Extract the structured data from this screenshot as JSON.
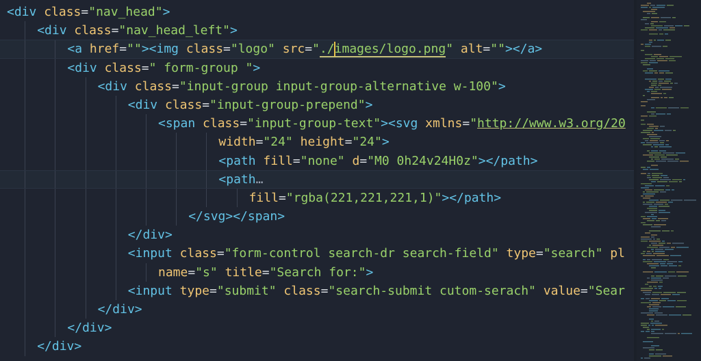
{
  "editor": {
    "language": "html",
    "lines": [
      {
        "indent": 0,
        "current": false,
        "tokens": [
          {
            "t": "tag",
            "v": "<div"
          },
          {
            "t": "sp",
            "v": " "
          },
          {
            "t": "attr",
            "v": "class"
          },
          {
            "t": "eq",
            "v": "="
          },
          {
            "t": "str",
            "v": "\"nav_head\""
          },
          {
            "t": "tag",
            "v": ">"
          }
        ]
      },
      {
        "indent": 1,
        "current": false,
        "tokens": [
          {
            "t": "tag",
            "v": "<div"
          },
          {
            "t": "sp",
            "v": " "
          },
          {
            "t": "attr",
            "v": "class"
          },
          {
            "t": "eq",
            "v": "="
          },
          {
            "t": "str",
            "v": "\"nav_head_left\""
          },
          {
            "t": "tag",
            "v": ">"
          }
        ]
      },
      {
        "indent": 2,
        "current": true,
        "tokens": [
          {
            "t": "tag",
            "v": "<a"
          },
          {
            "t": "sp",
            "v": " "
          },
          {
            "t": "attr",
            "v": "href"
          },
          {
            "t": "eq",
            "v": "="
          },
          {
            "t": "str",
            "v": "\"\""
          },
          {
            "t": "tag",
            "v": "><img"
          },
          {
            "t": "sp",
            "v": " "
          },
          {
            "t": "attr",
            "v": "class"
          },
          {
            "t": "eq",
            "v": "="
          },
          {
            "t": "str",
            "v": "\"logo\""
          },
          {
            "t": "sp",
            "v": " "
          },
          {
            "t": "attr",
            "v": "src"
          },
          {
            "t": "eq",
            "v": "="
          },
          {
            "t": "str",
            "v": "\""
          },
          {
            "t": "strul",
            "v": "./"
          },
          {
            "t": "cursor",
            "v": ""
          },
          {
            "t": "strul",
            "v": "images/logo.png"
          },
          {
            "t": "str",
            "v": "\""
          },
          {
            "t": "sp",
            "v": " "
          },
          {
            "t": "attr",
            "v": "alt"
          },
          {
            "t": "eq",
            "v": "="
          },
          {
            "t": "str",
            "v": "\"\""
          },
          {
            "t": "tag",
            "v": "></a>"
          }
        ]
      },
      {
        "indent": 2,
        "current": false,
        "tokens": [
          {
            "t": "tag",
            "v": "<div"
          },
          {
            "t": "sp",
            "v": " "
          },
          {
            "t": "attr",
            "v": "class"
          },
          {
            "t": "eq",
            "v": "="
          },
          {
            "t": "str",
            "v": "\" form-group \""
          },
          {
            "t": "tag",
            "v": ">"
          }
        ]
      },
      {
        "indent": 3,
        "current": false,
        "tokens": [
          {
            "t": "tag",
            "v": "<div"
          },
          {
            "t": "sp",
            "v": " "
          },
          {
            "t": "attr",
            "v": "class"
          },
          {
            "t": "eq",
            "v": "="
          },
          {
            "t": "str",
            "v": "\"input-group input-group-alternative w-100\""
          },
          {
            "t": "tag",
            "v": ">"
          }
        ]
      },
      {
        "indent": 4,
        "current": false,
        "tokens": [
          {
            "t": "tag",
            "v": "<div"
          },
          {
            "t": "sp",
            "v": " "
          },
          {
            "t": "attr",
            "v": "class"
          },
          {
            "t": "eq",
            "v": "="
          },
          {
            "t": "str",
            "v": "\"input-group-prepend\""
          },
          {
            "t": "tag",
            "v": ">"
          }
        ]
      },
      {
        "indent": 5,
        "current": false,
        "tokens": [
          {
            "t": "tag",
            "v": "<span"
          },
          {
            "t": "sp",
            "v": " "
          },
          {
            "t": "attr",
            "v": "class"
          },
          {
            "t": "eq",
            "v": "="
          },
          {
            "t": "str",
            "v": "\"input-group-text\""
          },
          {
            "t": "tag",
            "v": "><svg"
          },
          {
            "t": "sp",
            "v": " "
          },
          {
            "t": "attr",
            "v": "xmlns"
          },
          {
            "t": "eq",
            "v": "="
          },
          {
            "t": "str",
            "v": "\""
          },
          {
            "t": "url",
            "v": "http://www.w3.org/20"
          }
        ]
      },
      {
        "indent": 7,
        "current": false,
        "tokens": [
          {
            "t": "attr",
            "v": "width"
          },
          {
            "t": "eq",
            "v": "="
          },
          {
            "t": "str",
            "v": "\"24\""
          },
          {
            "t": "sp",
            "v": " "
          },
          {
            "t": "attr",
            "v": "height"
          },
          {
            "t": "eq",
            "v": "="
          },
          {
            "t": "str",
            "v": "\"24\""
          },
          {
            "t": "tag",
            "v": ">"
          }
        ]
      },
      {
        "indent": 7,
        "current": false,
        "tokens": [
          {
            "t": "tag",
            "v": "<path"
          },
          {
            "t": "sp",
            "v": " "
          },
          {
            "t": "attr",
            "v": "fill"
          },
          {
            "t": "eq",
            "v": "="
          },
          {
            "t": "str",
            "v": "\"none\""
          },
          {
            "t": "sp",
            "v": " "
          },
          {
            "t": "attr",
            "v": "d"
          },
          {
            "t": "eq",
            "v": "="
          },
          {
            "t": "str",
            "v": "\"M0 0h24v24H0z\""
          },
          {
            "t": "tag",
            "v": "></path>"
          }
        ]
      },
      {
        "indent": 7,
        "current": true,
        "tokens": [
          {
            "t": "tag",
            "v": "<path"
          },
          {
            "t": "fold",
            "v": "…"
          }
        ]
      },
      {
        "indent": 8,
        "current": false,
        "tokens": [
          {
            "t": "attr",
            "v": "fill"
          },
          {
            "t": "eq",
            "v": "="
          },
          {
            "t": "str",
            "v": "\"rgba(221,221,221,1)\""
          },
          {
            "t": "tag",
            "v": "></path>"
          }
        ]
      },
      {
        "indent": 6,
        "current": false,
        "tokens": [
          {
            "t": "tag",
            "v": "</svg></span>"
          }
        ]
      },
      {
        "indent": 4,
        "current": false,
        "tokens": [
          {
            "t": "tag",
            "v": "</div>"
          }
        ]
      },
      {
        "indent": 4,
        "current": false,
        "tokens": [
          {
            "t": "tag",
            "v": "<input"
          },
          {
            "t": "sp",
            "v": " "
          },
          {
            "t": "attr",
            "v": "class"
          },
          {
            "t": "eq",
            "v": "="
          },
          {
            "t": "str",
            "v": "\"form-control search-dr search-field\""
          },
          {
            "t": "sp",
            "v": " "
          },
          {
            "t": "attr",
            "v": "type"
          },
          {
            "t": "eq",
            "v": "="
          },
          {
            "t": "str",
            "v": "\"search\""
          },
          {
            "t": "sp",
            "v": " "
          },
          {
            "t": "attr",
            "v": "pl"
          }
        ]
      },
      {
        "indent": 5,
        "current": false,
        "tokens": [
          {
            "t": "attr",
            "v": "name"
          },
          {
            "t": "eq",
            "v": "="
          },
          {
            "t": "str",
            "v": "\"s\""
          },
          {
            "t": "sp",
            "v": " "
          },
          {
            "t": "attr",
            "v": "title"
          },
          {
            "t": "eq",
            "v": "="
          },
          {
            "t": "str",
            "v": "\"Search for:\""
          },
          {
            "t": "tag",
            "v": ">"
          }
        ]
      },
      {
        "indent": 4,
        "current": false,
        "tokens": [
          {
            "t": "tag",
            "v": "<input"
          },
          {
            "t": "sp",
            "v": " "
          },
          {
            "t": "attr",
            "v": "type"
          },
          {
            "t": "eq",
            "v": "="
          },
          {
            "t": "str",
            "v": "\"submit\""
          },
          {
            "t": "sp",
            "v": " "
          },
          {
            "t": "attr",
            "v": "class"
          },
          {
            "t": "eq",
            "v": "="
          },
          {
            "t": "str",
            "v": "\"search-submit cutom-serach\""
          },
          {
            "t": "sp",
            "v": " "
          },
          {
            "t": "attr",
            "v": "value"
          },
          {
            "t": "eq",
            "v": "="
          },
          {
            "t": "str",
            "v": "\"Sear"
          }
        ]
      },
      {
        "indent": 3,
        "current": false,
        "tokens": [
          {
            "t": "tag",
            "v": "</div>"
          }
        ]
      },
      {
        "indent": 2,
        "current": false,
        "tokens": [
          {
            "t": "tag",
            "v": "</div>"
          }
        ]
      },
      {
        "indent": 1,
        "current": false,
        "tokens": [
          {
            "t": "tag",
            "v": "</div>"
          }
        ]
      }
    ]
  },
  "colors": {
    "background": "#1f2430",
    "tag": "#63c3e6",
    "attribute": "#f0c674",
    "string": "#9ad26a",
    "cursor": "#e8c34a"
  }
}
